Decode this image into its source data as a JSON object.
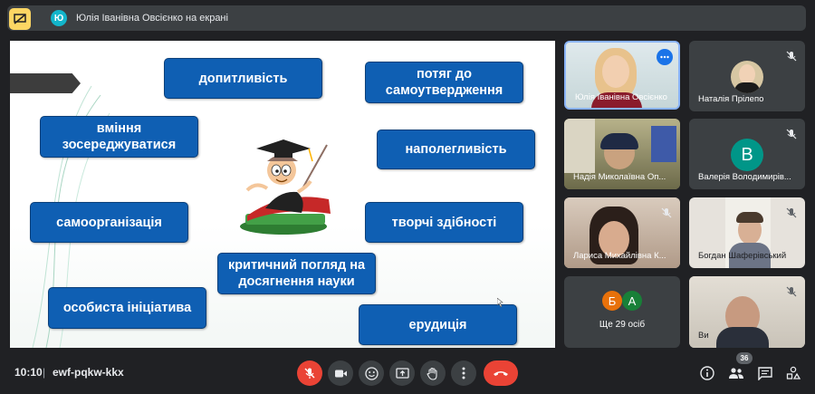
{
  "topbar": {
    "presenter_initial": "Ю",
    "presenter_label": "Юлія Іванівна Овсієнко на екрані"
  },
  "slide": {
    "terms": [
      "допитливість",
      "потяг до самоутвердження",
      "вміння зосереджуватися",
      "наполегливість",
      "самоорганізація",
      "творчі здібності",
      "критичний погляд на досягнення науки",
      "особиста ініціатива",
      "ерудиція"
    ]
  },
  "participants": [
    {
      "name": "Юлія Іванівна Овсієнко",
      "mic_off": false,
      "has_menu": true
    },
    {
      "name": "Наталія Прілепо",
      "mic_off": true
    },
    {
      "name": "Надія Миколаївна Оп...",
      "mic_off": false
    },
    {
      "name": "Валерія Володимирів...",
      "mic_off": true,
      "initial": "В"
    },
    {
      "name": "Лариса Михайлівна К...",
      "mic_off": true
    },
    {
      "name": "Богдан Шаферівський",
      "mic_off": true
    },
    {
      "name": "Ви",
      "mic_off": true
    }
  ],
  "more_tile": {
    "initials": [
      "Б",
      "А"
    ],
    "label": "Ще 29 осіб"
  },
  "bottom": {
    "time": "10:10",
    "separator": "|",
    "meeting_code": "ewf-pqkw-kkx",
    "participants_count": "36"
  },
  "colors": {
    "slide_pill": "#0f5fb3",
    "leave_red": "#ea4335",
    "present_yellow": "#fdd663",
    "avatar_teal": "#12b5cb"
  }
}
